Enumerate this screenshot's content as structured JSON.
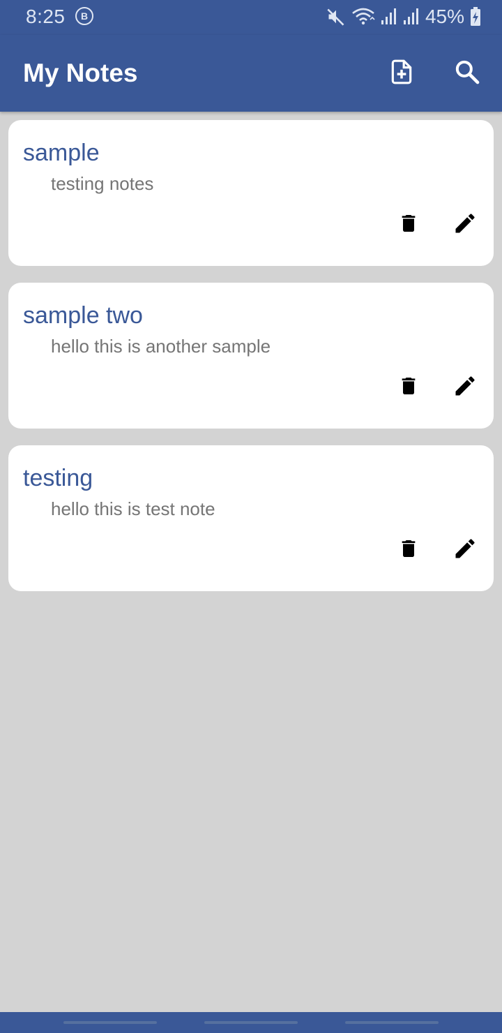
{
  "status_bar": {
    "time": "8:25",
    "notification_badge": "B",
    "battery_percent": "45%",
    "icons": [
      "mute-icon",
      "wifi-icon",
      "signal-icon",
      "signal-icon",
      "battery-charging-icon"
    ]
  },
  "app_bar": {
    "title": "My Notes",
    "actions": [
      "add-note-icon",
      "search-icon"
    ]
  },
  "notes": [
    {
      "title": "sample",
      "body": "testing notes"
    },
    {
      "title": "sample two",
      "body": "hello this is another sample"
    },
    {
      "title": "testing",
      "body": "hello this is test note"
    }
  ],
  "note_actions": [
    "delete-icon",
    "edit-icon"
  ],
  "colors": {
    "primary": "#3a5897",
    "background": "#d3d3d3",
    "card": "#ffffff",
    "note_title": "#3a5897",
    "note_body": "#757575"
  }
}
